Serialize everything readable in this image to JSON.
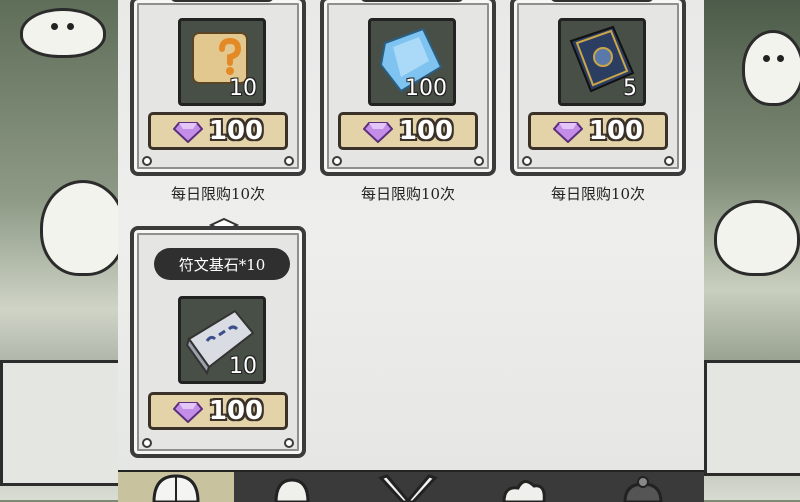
{
  "shop": {
    "cards": [
      {
        "name": "",
        "item_icon": "scroll-question-icon",
        "count": "10",
        "price": "100",
        "currency_icon": "gem-icon",
        "limit": "每日限购10次"
      },
      {
        "name": "",
        "item_icon": "crystal-icon",
        "count": "100",
        "price": "100",
        "currency_icon": "gem-icon",
        "limit": "每日限购10次"
      },
      {
        "name": "",
        "item_icon": "rune-book-icon",
        "count": "5",
        "price": "100",
        "currency_icon": "gem-icon",
        "limit": "每日限购10次"
      },
      {
        "name": "符文基石*10",
        "item_icon": "rune-stone-icon",
        "count": "10",
        "price": "100",
        "currency_icon": "gem-icon",
        "limit": ""
      }
    ]
  },
  "colors": {
    "gem": "#b07ae0",
    "price_bg": "#e4d3a8",
    "panel": "#e9e9e8",
    "frame": "#3b3b3b"
  },
  "bottom_nav": {
    "tabs": [
      "helmet-icon",
      "scroll-icon",
      "crossed-swords-icon",
      "cloud-icon",
      "cauldron-icon"
    ]
  }
}
